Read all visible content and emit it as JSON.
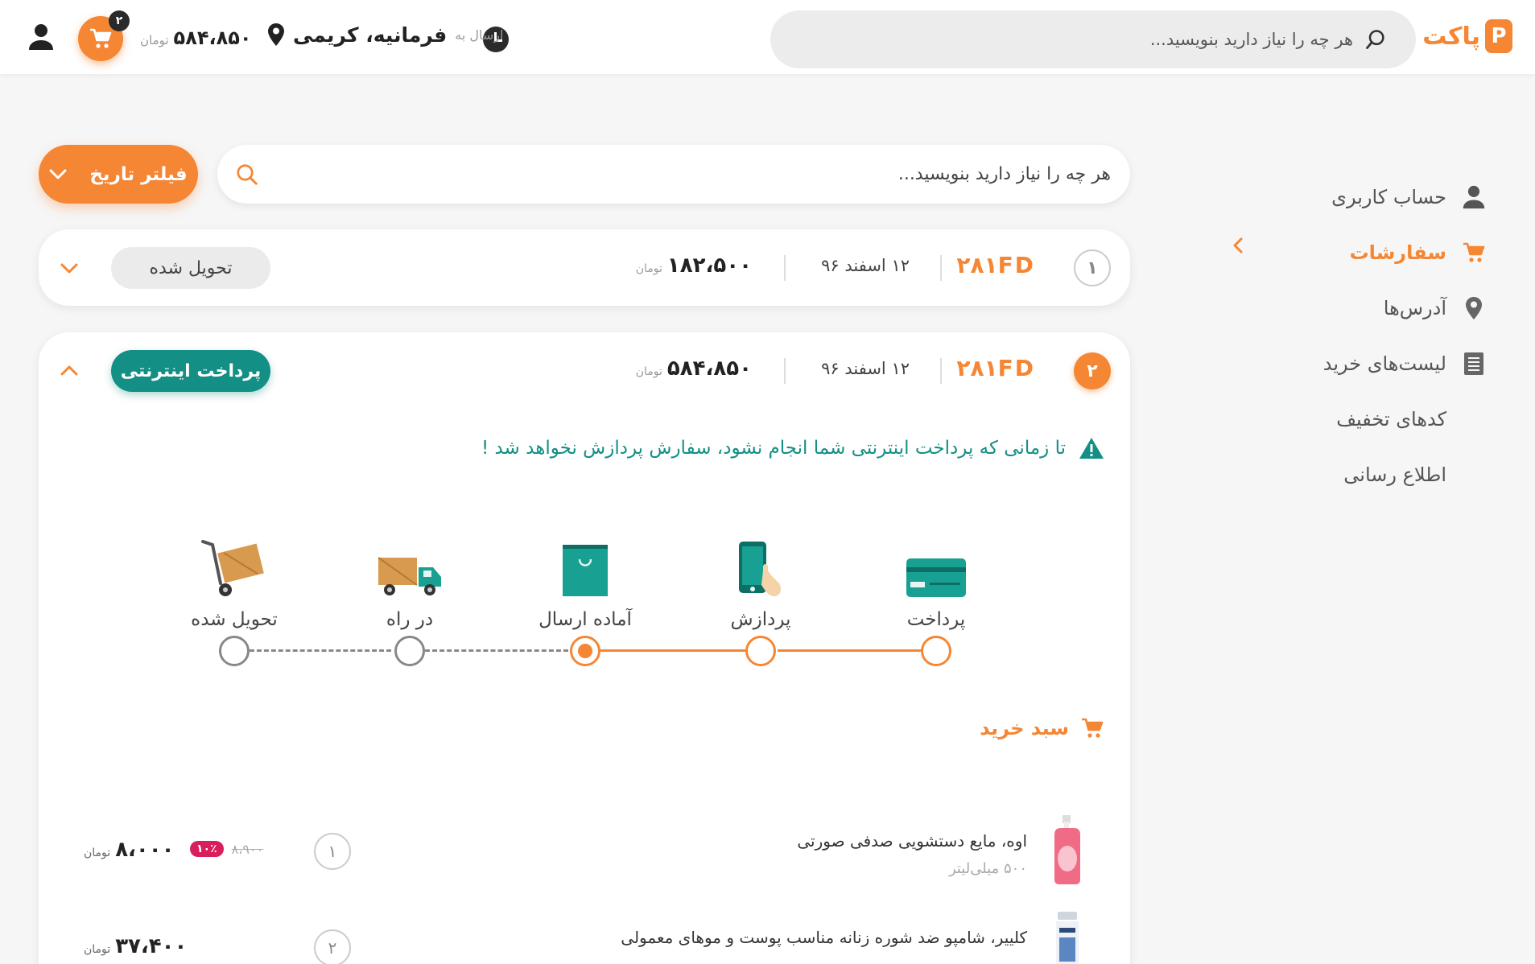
{
  "header": {
    "logo_text": "پاکت",
    "logo_mark": "P",
    "search_placeholder": "هر چه را نیاز دارید بنویسید...",
    "ship_label": "ارسال به",
    "ship_address": "فرمانیه، کریمی",
    "cart_total": "۵۸۴،۸۵۰",
    "cart_unit": "تومان",
    "cart_count": "۲"
  },
  "sidebar": {
    "items": [
      {
        "label": "حساب کاربری",
        "icon": "user-icon"
      },
      {
        "label": "سفارشات",
        "icon": "cart-icon",
        "active": true
      },
      {
        "label": "آدرس‌ها",
        "icon": "location-pin-icon"
      },
      {
        "label": "لیست‌های خرید",
        "icon": "list-icon"
      },
      {
        "label": "کدهای تخفیف",
        "icon": ""
      },
      {
        "label": "اطلاع رسانی",
        "icon": ""
      }
    ]
  },
  "filter": {
    "button_label": "فیلتر تاریخ",
    "search_placeholder": "هر چه را نیاز دارید بنویسید..."
  },
  "orders": [
    {
      "index": "۱",
      "code": "۲۸۱FD",
      "date": "۱۲ اسفند ۹۶",
      "price": "۱۸۲،۵۰۰",
      "unit": "تومان",
      "status": "تحویل شده"
    },
    {
      "index": "۲",
      "code": "۲۸۱FD",
      "date": "۱۲ اسفند ۹۶",
      "price": "۵۸۴،۸۵۰",
      "unit": "تومان",
      "status": "پرداخت اینترنتی",
      "warning": "تا زمانی که پرداخت اینترنتی شما انجام نشود، سفارش پردازش نخواهد شد !",
      "steps": [
        {
          "label": "پرداخت",
          "state": "done"
        },
        {
          "label": "پردازش",
          "state": "done"
        },
        {
          "label": "آماده ارسال",
          "state": "current"
        },
        {
          "label": "در راه",
          "state": "pending"
        },
        {
          "label": "تحویل شده",
          "state": "pending"
        }
      ],
      "basket_title": "سبد خرید",
      "items": [
        {
          "name": "اوه، مایع دستشویی صدفی صورتی",
          "size": "۵۰۰ میلی‌لیتر",
          "qty": "۱",
          "old_price": "۸،۹۰۰",
          "discount": "۱۰٪",
          "price": "۸،۰۰۰",
          "unit": "تومان"
        },
        {
          "name": "کلییر، شامپو ضد شوره زنانه مناسب پوست و موهای معمولی",
          "size": "",
          "qty": "۲",
          "price": "۳۷،۴۰۰",
          "unit": "تومان"
        }
      ]
    }
  ],
  "colors": {
    "accent": "#f58634",
    "teal": "#138f85",
    "discount": "#d81e5b"
  }
}
